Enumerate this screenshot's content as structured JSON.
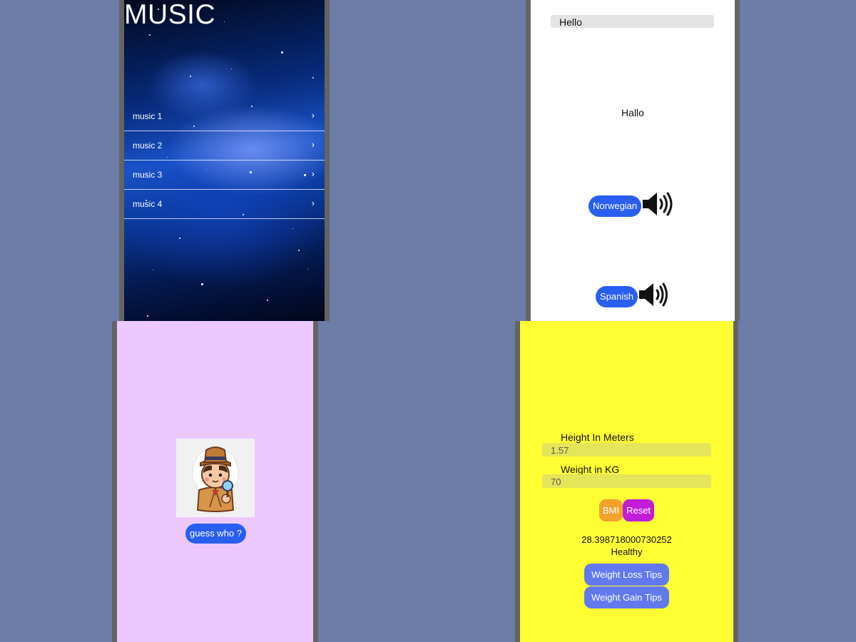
{
  "music": {
    "title": "MUSIC",
    "items": [
      {
        "label": "music 1",
        "chevron": "›"
      },
      {
        "label": "music 2",
        "chevron": "›"
      },
      {
        "label": "music 3",
        "chevron": "›"
      },
      {
        "label": "music 4",
        "chevron": "›"
      }
    ]
  },
  "translator": {
    "input_value": "Hello",
    "result": "Hallo",
    "languages": [
      {
        "label": "Norwegian",
        "icon": "speaker-icon"
      },
      {
        "label": "Spanish",
        "icon": "speaker-icon"
      }
    ],
    "button_color": "#2a5ef0"
  },
  "guess": {
    "image_icon": "detective-icon",
    "button_label": "guess who ?",
    "background": "#ecc8fe"
  },
  "bmi": {
    "height_label": "Height In Meters",
    "height_value": "1.57",
    "weight_label": "Weight in KG",
    "weight_value": "70",
    "bmi_button": "BMI",
    "reset_button": "Reset",
    "result_value": "28.398718000730252",
    "result_status": "Healthy",
    "weight_loss_button": "Weight Loss Tips",
    "weight_gain_button": "Weight Gain Tips",
    "colors": {
      "background": "#ffff33",
      "bmi": "#f2a22b",
      "reset": "#c11dd8",
      "tips": "#6279ee"
    }
  }
}
